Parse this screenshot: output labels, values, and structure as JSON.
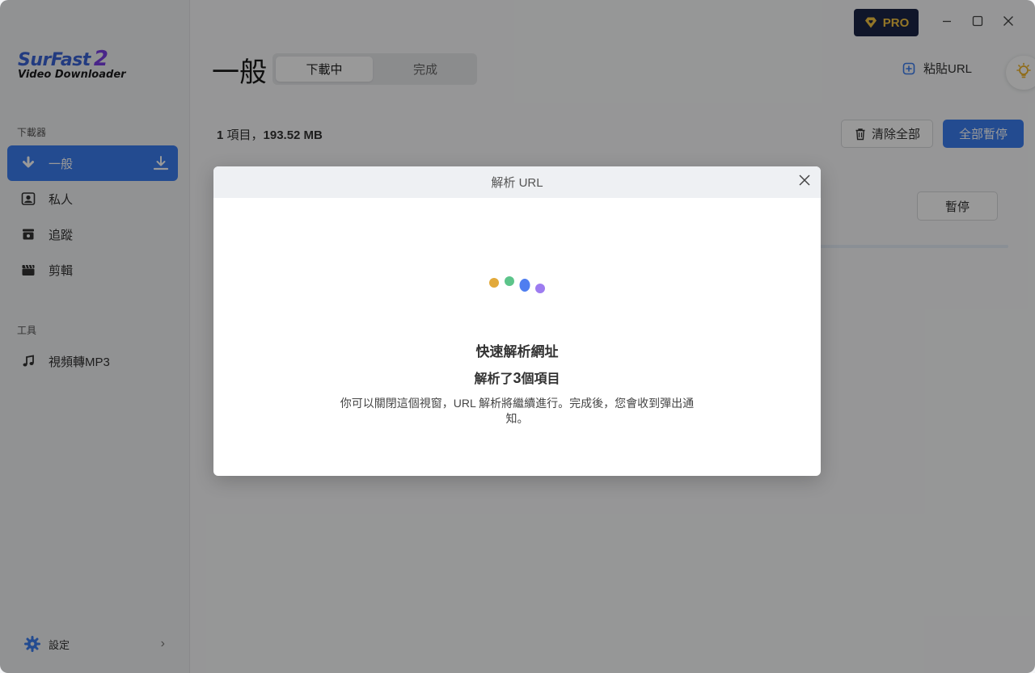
{
  "window": {
    "pro_label": "PRO",
    "controls": [
      "minimize-icon",
      "maximize-icon",
      "close-icon"
    ]
  },
  "sidebar": {
    "logo_title": "SurFast",
    "logo_version": "2",
    "logo_subtitle": "Video Downloader",
    "downloader_section": "下載器",
    "items": [
      {
        "label": "一般",
        "icon": "download-arrow-icon",
        "active": true
      },
      {
        "label": "私人",
        "icon": "private-portrait-icon",
        "active": false
      },
      {
        "label": "追蹤",
        "icon": "tracking-box-icon",
        "active": false
      },
      {
        "label": "剪輯",
        "icon": "clapperboard-icon",
        "active": false
      }
    ],
    "tools_section": "工具",
    "tools": [
      {
        "label": "視頻轉MP3",
        "icon": "music-note-icon"
      }
    ],
    "settings_label": "設定"
  },
  "main": {
    "title": "一般",
    "tabs": [
      {
        "label": "下載中",
        "selected": true
      },
      {
        "label": "完成",
        "selected": false
      }
    ],
    "paste_url": "粘貼URL",
    "summary_count": "1",
    "summary_items": " 項目，",
    "summary_size": "193.52 MB",
    "clear_all": "清除全部",
    "pause_all": "全部暫停",
    "pause": "暫停"
  },
  "modal": {
    "title": "解析 URL",
    "heading": "快速解析網址",
    "parsed_prefix": "解析了",
    "parsed_count": "3",
    "parsed_suffix": "個項目",
    "description": "你可以關閉這個視窗，URL 解析將繼續進行。完成後，您會收到彈出通知。"
  },
  "colors": {
    "accent": "#3b7df0",
    "pro_bg": "#1c2547",
    "pro_text": "#f6c542",
    "dot_yellow": "#e2a93a",
    "dot_green": "#5cc48a",
    "dot_blue": "#4f7ef0",
    "dot_purple": "#9d7cf0"
  }
}
